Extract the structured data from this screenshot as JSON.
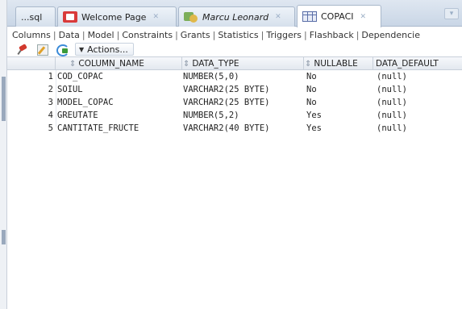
{
  "tabs": [
    {
      "label": "...sql",
      "icon": "none"
    },
    {
      "label": "Welcome Page",
      "icon": "welcome-page-icon"
    },
    {
      "label": "Marcu Leonard",
      "icon": "connection-icon"
    },
    {
      "label": "COPACI",
      "icon": "table-icon"
    }
  ],
  "subtabs": [
    "Columns",
    "Data",
    "Model",
    "Constraints",
    "Grants",
    "Statistics",
    "Triggers",
    "Flashback",
    "Dependencie"
  ],
  "toolbar": {
    "actions_label": "Actions..."
  },
  "grid": {
    "headers": {
      "column_name": "COLUMN_NAME",
      "data_type": "DATA_TYPE",
      "nullable": "NULLABLE",
      "data_default": "DATA_DEFAULT"
    },
    "rows": [
      {
        "num": "1",
        "column_name": "COD_COPAC",
        "data_type": "NUMBER(5,0)",
        "nullable": "No",
        "data_default": "(null)"
      },
      {
        "num": "2",
        "column_name": "SOIUL",
        "data_type": "VARCHAR2(25 BYTE)",
        "nullable": "No",
        "data_default": "(null)"
      },
      {
        "num": "3",
        "column_name": "MODEL_COPAC",
        "data_type": "VARCHAR2(25 BYTE)",
        "nullable": "No",
        "data_default": "(null)"
      },
      {
        "num": "4",
        "column_name": "GREUTATE",
        "data_type": "NUMBER(5,2)",
        "nullable": "Yes",
        "data_default": "(null)"
      },
      {
        "num": "5",
        "column_name": "CANTITATE_FRUCTE",
        "data_type": "VARCHAR2(40 BYTE)",
        "nullable": "Yes",
        "data_default": "(null)"
      }
    ]
  },
  "colors": {
    "tab_strip": "#c9d6e6",
    "header_bg": "#e3e8ef",
    "welcome_icon": "#d93a3a"
  }
}
